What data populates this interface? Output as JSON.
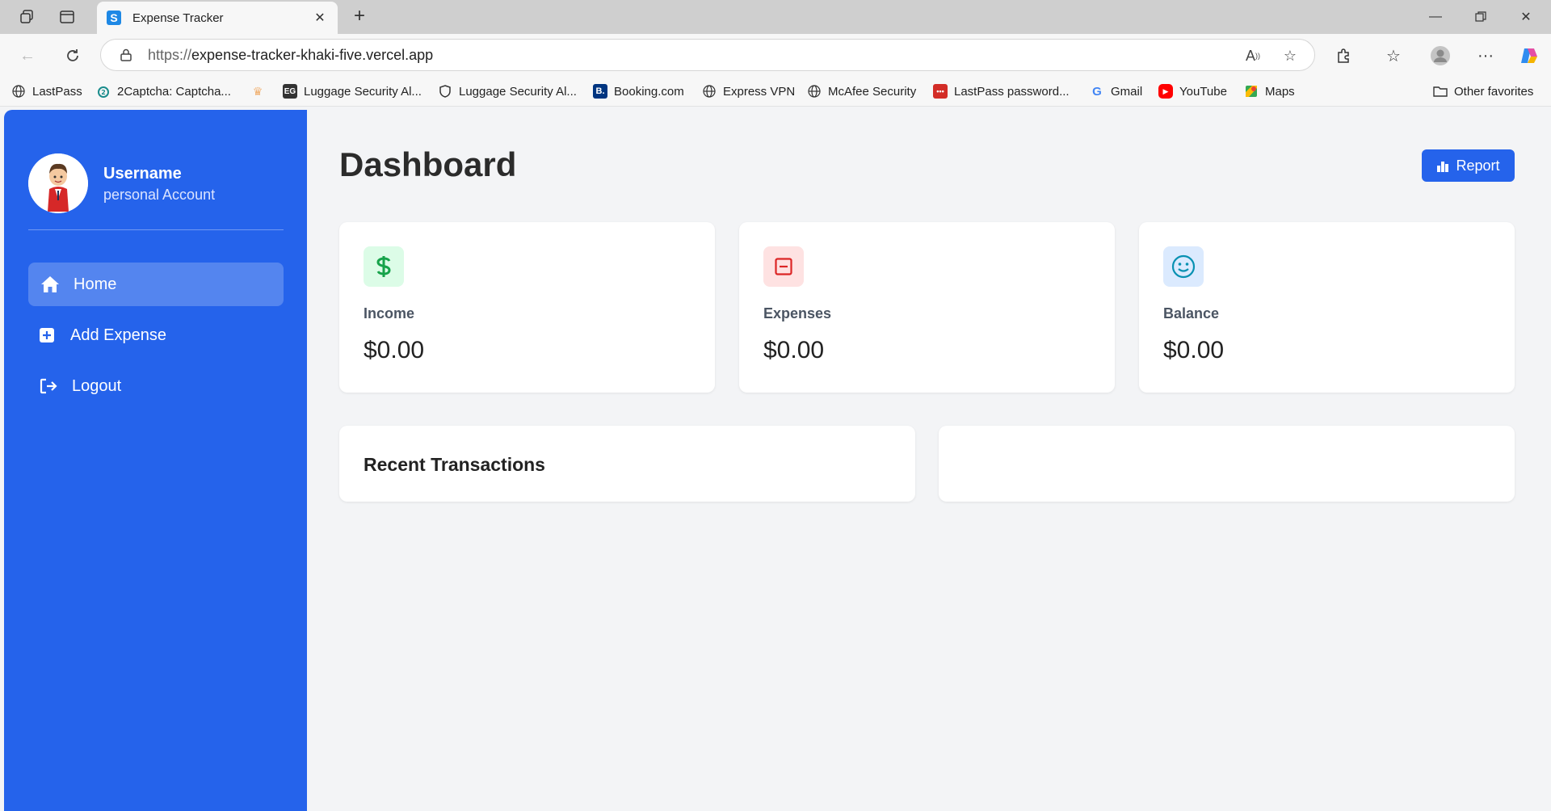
{
  "browser": {
    "tab_title": "Expense Tracker",
    "url_scheme": "https://",
    "url_host": "expense-tracker-khaki-five.vercel.app",
    "bookmarks": [
      {
        "label": "LastPass",
        "icon": "globe-icon"
      },
      {
        "label": "2Captcha: Captcha...",
        "icon": "captcha-icon"
      },
      {
        "label": "",
        "icon": "crown-icon"
      },
      {
        "label": "Luggage Security Al...",
        "icon": "eg-icon"
      },
      {
        "label": "Luggage Security Al...",
        "icon": "shield-icon"
      },
      {
        "label": "Booking.com",
        "icon": "booking-icon"
      },
      {
        "label": "Express VPN",
        "icon": "globe-icon"
      },
      {
        "label": "McAfee Security",
        "icon": "globe-icon"
      },
      {
        "label": "LastPass password...",
        "icon": "lastpass-icon"
      },
      {
        "label": "Gmail",
        "icon": "google-icon"
      },
      {
        "label": "YouTube",
        "icon": "youtube-icon"
      },
      {
        "label": "Maps",
        "icon": "maps-icon"
      }
    ],
    "other_favorites": "Other favorites"
  },
  "sidebar": {
    "username": "Username",
    "account_type": "personal Account",
    "nav": [
      {
        "label": "Home",
        "icon": "home-icon",
        "active": true
      },
      {
        "label": "Add Expense",
        "icon": "plus-square-icon",
        "active": false
      },
      {
        "label": "Logout",
        "icon": "logout-icon",
        "active": false
      }
    ]
  },
  "main": {
    "title": "Dashboard",
    "report_label": "Report",
    "stats": [
      {
        "label": "Income",
        "value": "$0.00",
        "icon": "dollar-icon",
        "color": "#16a34a",
        "bg": "#dcfce7"
      },
      {
        "label": "Expenses",
        "value": "$0.00",
        "icon": "minus-square-icon",
        "color": "#dc2626",
        "bg": "#fee2e2"
      },
      {
        "label": "Balance",
        "value": "$0.00",
        "icon": "smile-icon",
        "color": "#0891b2",
        "bg": "#dbeafe"
      }
    ],
    "recent_title": "Recent Transactions"
  },
  "colors": {
    "accent": "#2563eb",
    "background": "#f3f4f6"
  }
}
